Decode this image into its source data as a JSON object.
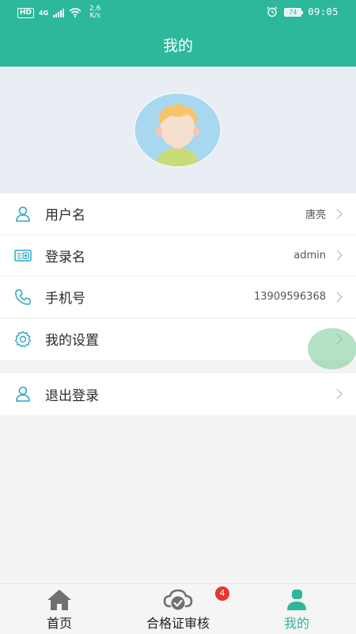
{
  "status_bar": {
    "hd": "HD",
    "network": "4G",
    "speed": "2.6",
    "speed_unit": "K/s",
    "battery": "74",
    "time": "09:05"
  },
  "header": {
    "title": "我的"
  },
  "profile": {
    "avatar_icon": "child-avatar-icon"
  },
  "menu": {
    "items": [
      {
        "icon": "user-icon",
        "label": "用户名",
        "value": "唐亮"
      },
      {
        "icon": "id-card-icon",
        "label": "登录名",
        "value": "admin"
      },
      {
        "icon": "phone-icon",
        "label": "手机号",
        "value": "13909596368"
      },
      {
        "icon": "gear-icon",
        "label": "我的设置",
        "value": ""
      }
    ],
    "logout": {
      "icon": "user-icon",
      "label": "退出登录"
    }
  },
  "bottom_nav": {
    "tabs": [
      {
        "label": "首页",
        "icon": "home-icon"
      },
      {
        "label": "合格证审核",
        "icon": "cloud-check-icon",
        "badge": "4"
      },
      {
        "label": "我的",
        "icon": "person-icon",
        "active": true
      }
    ]
  },
  "colors": {
    "primary": "#2db79b",
    "badge": "#e8342e",
    "header_bg": "#e8eef3"
  }
}
